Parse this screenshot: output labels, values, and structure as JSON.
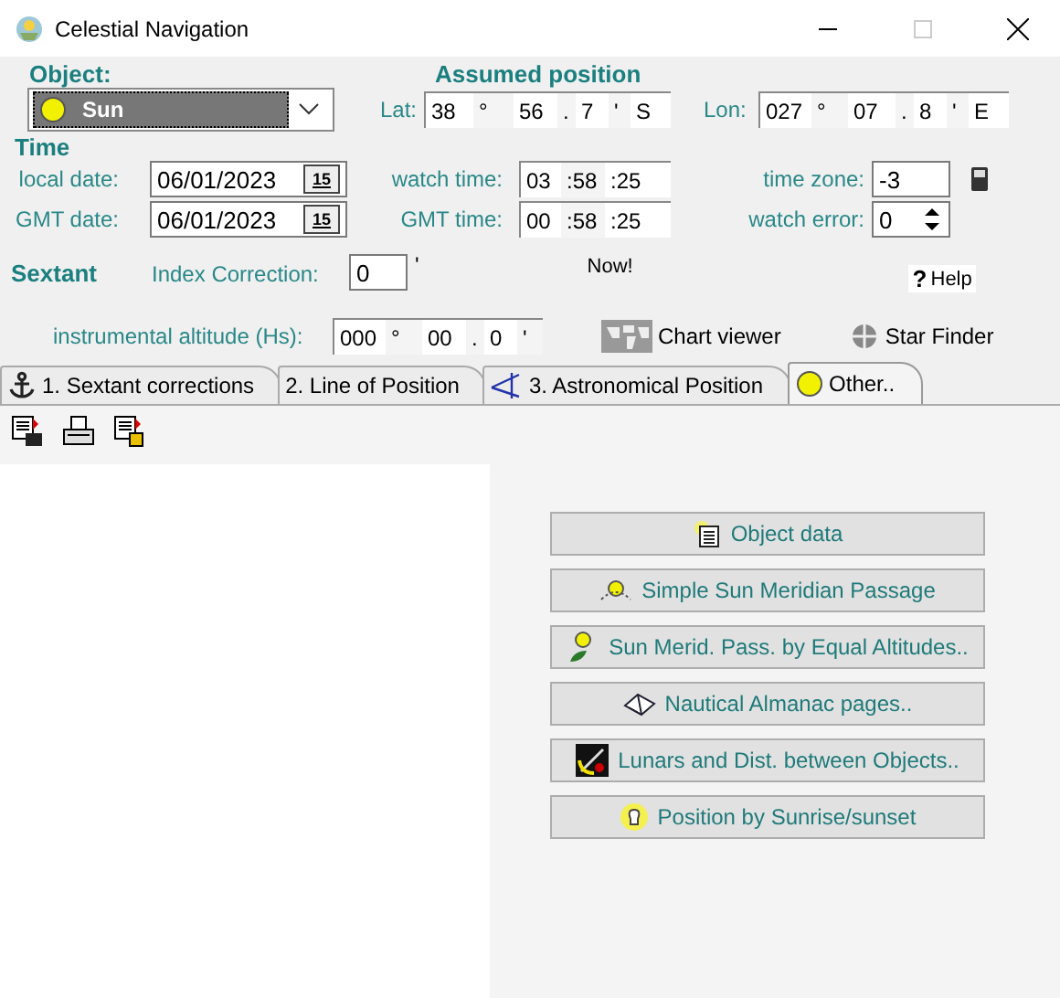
{
  "window": {
    "title": "Celestial Navigation"
  },
  "object": {
    "label": "Object:",
    "value": "Sun"
  },
  "assumed_position": {
    "title": "Assumed position",
    "lat": {
      "label": "Lat:",
      "parts": [
        "38",
        "°",
        "56",
        ".",
        "7",
        "'",
        "S"
      ]
    },
    "lon": {
      "label": "Lon:",
      "parts": [
        "027",
        "°",
        "07",
        ".",
        "8",
        "'",
        "E"
      ]
    }
  },
  "time": {
    "title": "Time",
    "local_date": {
      "label": "local date:",
      "value": "06/01/2023",
      "calendar_day": "15"
    },
    "gmt_date": {
      "label": "GMT date:",
      "value": "06/01/2023",
      "calendar_day": "15"
    },
    "watch_time": {
      "label": "watch time:",
      "parts": [
        "03",
        ":58",
        ":25"
      ]
    },
    "gmt_time": {
      "label": "GMT time:",
      "parts": [
        "00",
        ":58",
        ":25"
      ]
    },
    "time_zone": {
      "label": "time zone:",
      "value": "-3"
    },
    "watch_error": {
      "label": "watch error:",
      "value": "0"
    }
  },
  "sextant": {
    "title": "Sextant",
    "index_correction": {
      "label": "Index Correction:",
      "value": "0",
      "unit": "'"
    },
    "now": "Now!",
    "help_mark": "?",
    "help": "Help"
  },
  "altitude": {
    "label": "instrumental altitude (Hs):",
    "parts": [
      "000",
      "°",
      "00",
      ".",
      "0",
      "'"
    ]
  },
  "tools": [
    {
      "label": "Chart viewer"
    },
    {
      "label": "Star Finder"
    }
  ],
  "tabs": [
    {
      "label": "1. Sextant corrections",
      "selected": false
    },
    {
      "label": "2. Line of Position",
      "selected": false
    },
    {
      "label": "3. Astronomical Position",
      "selected": false
    },
    {
      "label": "Other..",
      "selected": true
    }
  ],
  "actions": [
    {
      "label": "Object data"
    },
    {
      "label": "Simple Sun Meridian Passage"
    },
    {
      "label": "Sun Merid. Pass. by Equal Altitudes.."
    },
    {
      "label": "Nautical Almanac pages.."
    },
    {
      "label": "Lunars and Dist. between Objects.."
    },
    {
      "label": "Position by Sunrise/sunset"
    }
  ]
}
